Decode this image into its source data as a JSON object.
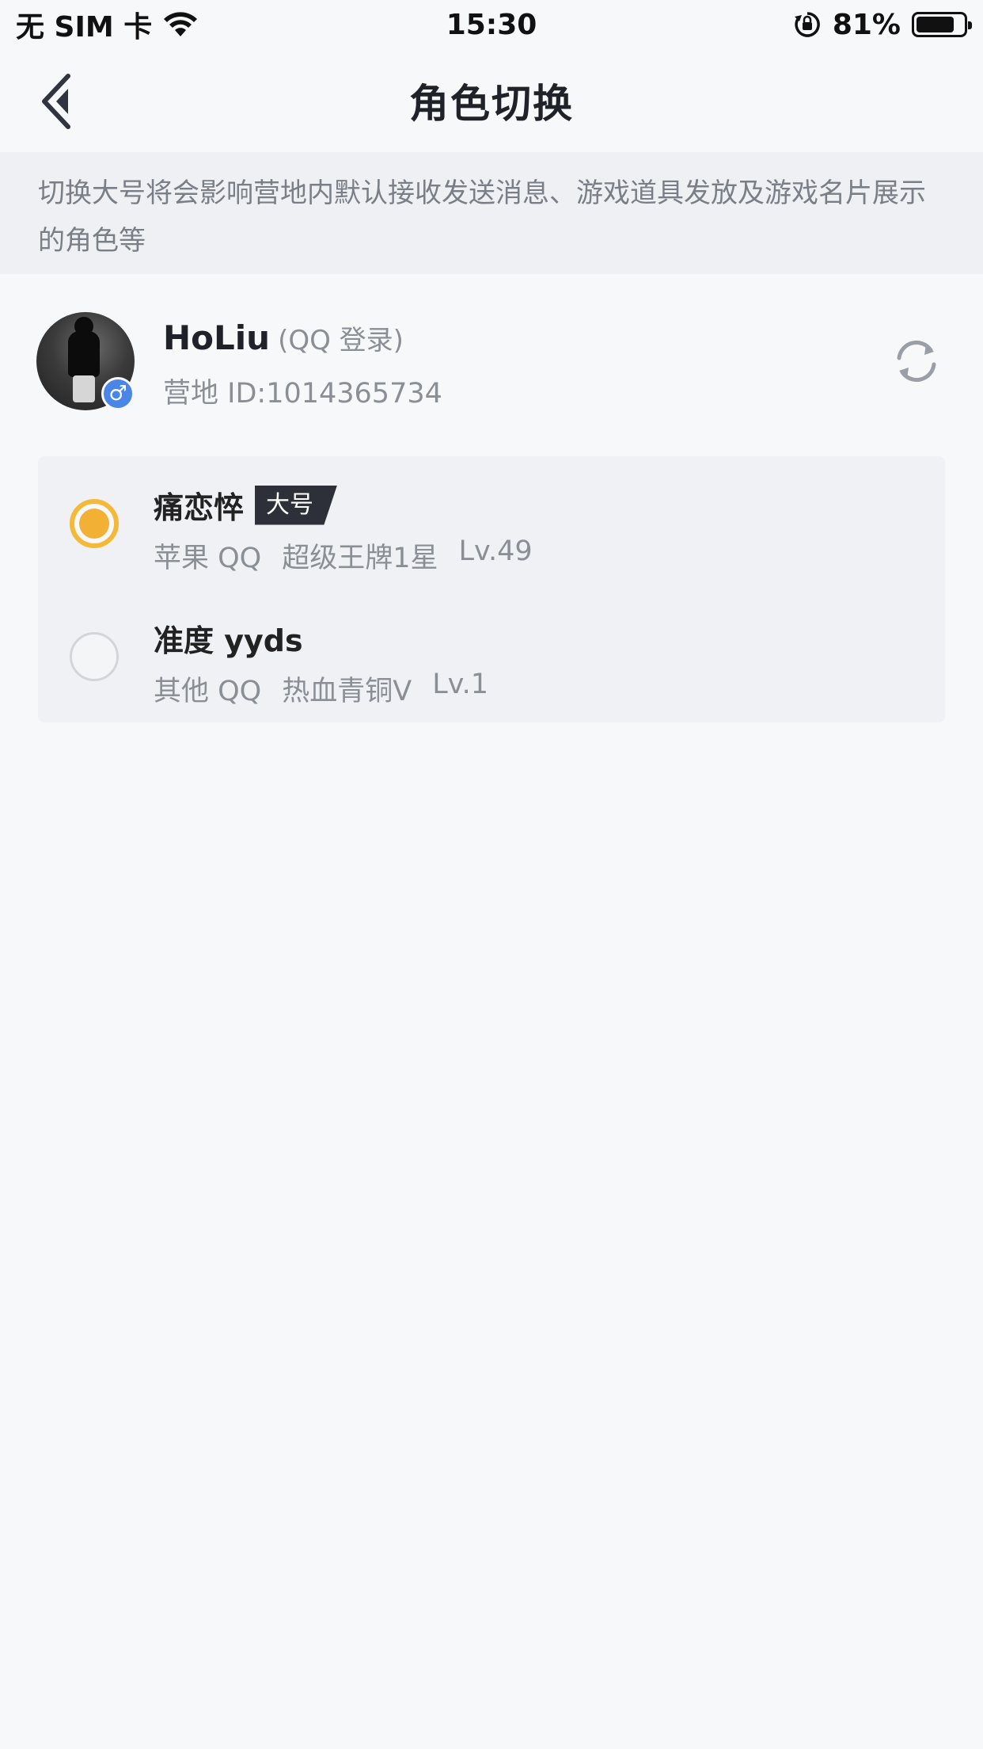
{
  "status_bar": {
    "carrier": "无 SIM 卡",
    "time": "15:30",
    "battery_percent": "81%",
    "battery_level": 0.81
  },
  "nav": {
    "title": "角色切换"
  },
  "notice": {
    "text": "切换大号将会影响营地内默认接收发送消息、游戏道具发放及游戏名片展示的角色等"
  },
  "profile": {
    "name": "HoLiu",
    "login_method": "(QQ 登录)",
    "camp_id": "营地 ID:1014365734",
    "gender_symbol": "♂"
  },
  "roles": [
    {
      "name": "痛恋悴",
      "tag": "大号",
      "platform": "苹果 QQ",
      "rank": "超级王牌1星",
      "level": "Lv.49",
      "selected": true
    },
    {
      "name": "准度 yyds",
      "tag": "",
      "platform": "其他 QQ",
      "rank": "热血青铜Ⅴ",
      "level": "Lv.1",
      "selected": false
    }
  ],
  "colors": {
    "accent": "#f2b035",
    "background": "#f7f8fa",
    "notice_bg": "#eef0f3",
    "tag_bg": "#2d3039",
    "gender_badge": "#4a86e8"
  }
}
